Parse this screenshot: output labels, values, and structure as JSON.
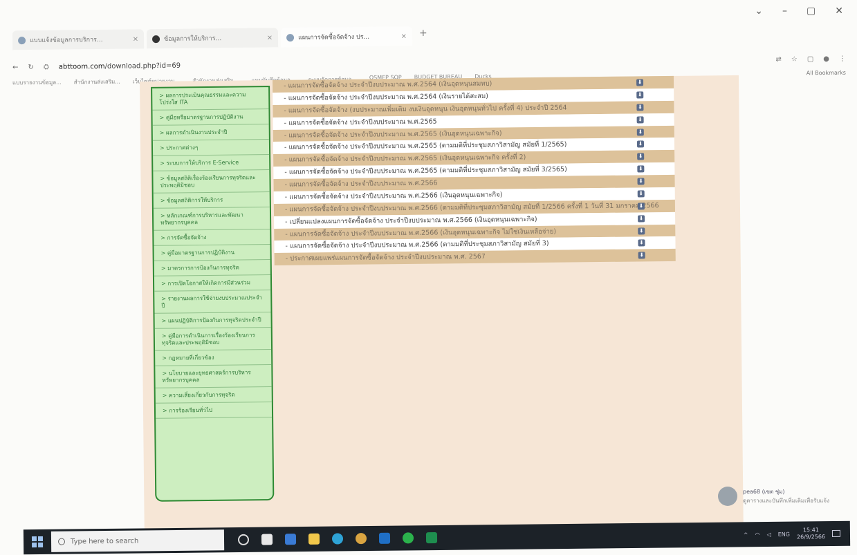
{
  "browser": {
    "tabs": [
      {
        "label": "แบบแจ้งข้อมูลการบริการ...",
        "active": false
      },
      {
        "label": "ข้อมูลการให้บริการ...",
        "active": false
      },
      {
        "label": "แผนการจัดซื้อจัดจ้าง ปร...",
        "active": true
      }
    ],
    "address": "abttoom.com/download.php?id=69",
    "address_domain": "abttoom.com",
    "address_path": "/download.php?id=69",
    "bookmarks": [
      "แบบรายงานข้อมูล...",
      "สำนักงานส่งเสริม...",
      "เว็บไซต์หน่วยงาน...",
      "สำนักงานส่งเสริม...",
      "แบบบันทึกข้อมูล...",
      "ระบบจัดการข้อมูล...",
      "OSMEP SOP",
      "BUDGET BUREAU",
      "Ducks"
    ],
    "all_bookmarks": "All Bookmarks"
  },
  "sidebar": {
    "items": [
      "> ผลการประเมินคุณธรรมและความโปร่งใส ITA",
      "> คู่มือหรือมาตรฐานการปฏิบัติงาน",
      "> ผลการดำเนินงานประจำปี",
      "> ประกาศต่างๆ",
      "> ระบบการให้บริการ E-Service",
      "> ข้อมูลสถิติเรื่องร้องเรียนการทุจริตและประพฤติมิชอบ",
      "> ข้อมูลสถิติการให้บริการ",
      "> หลักเกณฑ์การบริหารและพัฒนาทรัพยากรบุคคล",
      "> การจัดซื้อจัดจ้าง",
      "> คู่มือมาตรฐานการปฏิบัติงาน",
      "> มาตรการการป้องกันการทุจริต",
      "> การเปิดโอกาสให้เกิดการมีส่วนร่วม",
      "> รายงานผลการใช้จ่ายงบประมาณประจำปี",
      "> แผนปฏิบัติการป้องกันการทุจริตประจำปี",
      "> คู่มือการดำเนินการเรื่องร้องเรียนการทุจริตและประพฤติมิชอบ",
      "> กฎหมายที่เกี่ยวข้อง",
      "> นโยบายและยุทธศาสตร์การบริหารทรัพยากรบุคคล",
      "> ความเสี่ยงเกี่ยวกับการทุจริต",
      "> การร้องเรียนทั่วไป"
    ]
  },
  "downloads": [
    {
      "text": "- แผนการจัดซื้อจัดจ้าง ประจำปีงบประมาณ พ.ศ.2564 (เงินอุดหนุนสมทบ)",
      "style": "tan"
    },
    {
      "text": "- แผนการจัดซื้อจัดจ้าง ประจำปีงบประมาณ พ.ศ.2564 (เงินรายได้สะสม)",
      "style": "white"
    },
    {
      "text": "- แผนการจัดซื้อจัดจ้าง (งบประมาณเพิ่มเติม งบเงินอุดหนุน เงินอุดหนุนทั่วไป ครั้งที่ 4) ประจำปี 2564",
      "style": "tan"
    },
    {
      "text": "- แผนการจัดซื้อจัดจ้าง ประจำปีงบประมาณ พ.ศ.2565",
      "style": "white"
    },
    {
      "text": "- แผนการจัดซื้อจัดจ้าง ประจำปีงบประมาณ พ.ศ.2565 (เงินอุดหนุนเฉพาะกิจ)",
      "style": "tan"
    },
    {
      "text": "- แผนการจัดซื้อจัดจ้าง ประจำปีงบประมาณ พ.ศ.2565 (ตามมติที่ประชุมสภาวิสามัญ สมัยที่ 1/2565)",
      "style": "white"
    },
    {
      "text": "- แผนการจัดซื้อจัดจ้าง ประจำปีงบประมาณ พ.ศ.2565 (เงินอุดหนุนเฉพาะกิจ ครั้งที่ 2)",
      "style": "tan"
    },
    {
      "text": "- แผนการจัดซื้อจัดจ้าง ประจำปีงบประมาณ พ.ศ.2565 (ตามมติที่ประชุมสภาวิสามัญ สมัยที่ 3/2565)",
      "style": "white"
    },
    {
      "text": "- แผนการจัดซื้อจัดจ้าง ประจำปีงบประมาณ พ.ศ.2566",
      "style": "tan"
    },
    {
      "text": "- แผนการจัดซื้อจัดจ้าง ประจำปีงบประมาณ พ.ศ.2566 (เงินอุดหนุนเฉพาะกิจ)",
      "style": "white"
    },
    {
      "text": "- แผนการจัดซื้อจัดจ้าง ประจำปีงบประมาณ พ.ศ.2566 (ตามมติที่ประชุมสภาวิสามัญ สมัยที่ 1/2566 ครั้งที่ 1 วันที่ 31 มกราคม 2566",
      "style": "tan"
    },
    {
      "text": "- เปลี่ยนแปลงแผนการจัดซื้อจัดจ้าง ประจำปีงบประมาณ พ.ศ.2566 (เงินอุดหนุนเฉพาะกิจ)",
      "style": "white"
    },
    {
      "text": "- แผนการจัดซื้อจัดจ้าง ประจำปีงบประมาณ พ.ศ.2566 (เงินอุดหนุนเฉพาะกิจ ไม่ใช่เงินเหลือจ่าย)",
      "style": "tan"
    },
    {
      "text": "- แผนการจัดซื้อจัดจ้าง ประจำปีงบประมาณ พ.ศ.2566 (ตามมติที่ประชุมสภาวิสามัญ สมัยที่ 3)",
      "style": "white"
    },
    {
      "text": "- ประกาศเผยแพร่แผนการจัดซื้อจัดจ้าง ประจำปีงบประมาณ พ.ศ. 2567",
      "style": "tan"
    }
  ],
  "taskbar": {
    "search_placeholder": "Type here to search",
    "lang": "ENG",
    "time": "15:41",
    "date": "26/9/2566"
  },
  "notification": {
    "title": "pea68 (เขต ชุ่ม)",
    "body": "ดูตารางและบันทึกเพิ่มเติมเพื่อรับแจ้ง"
  }
}
